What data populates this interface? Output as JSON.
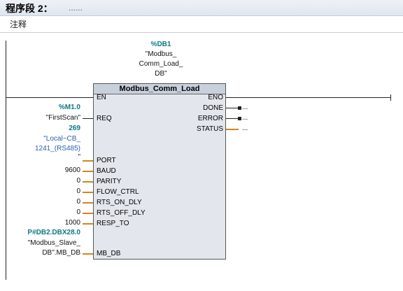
{
  "header": {
    "title": "程序段 2：",
    "dots": "......"
  },
  "comment": {
    "label": "注释"
  },
  "instance": {
    "address": "%DB1",
    "name_lines": [
      "\"Modbus_",
      "Comm_Load_",
      "DB\""
    ]
  },
  "block": {
    "title": "Modbus_Comm_Load",
    "pins_in": [
      "EN",
      "REQ",
      "PORT",
      "BAUD",
      "PARITY",
      "FLOW_CTRL",
      "RTS_ON_DLY",
      "RTS_OFF_DLY",
      "RESP_TO",
      "MB_DB"
    ],
    "pins_out": [
      "ENO",
      "DONE",
      "ERROR",
      "STATUS"
    ]
  },
  "params": {
    "req_addr": "%M1.0",
    "req_name": "\"FirstScan\"",
    "port_value": "269",
    "port_name_lines": [
      "\"Local~CB_",
      "1241_(RS485)",
      "\""
    ],
    "baud": "9600",
    "parity": "0",
    "flow_ctrl": "0",
    "rts_on_dly": "0",
    "rts_off_dly": "0",
    "resp_to": "1000",
    "mb_db_addr": "P#DB2.DBX28.0",
    "mb_db_lines": [
      "\"Modbus_Slave_",
      "DB\".MB_DB"
    ]
  },
  "outputs": {
    "done": "...",
    "error": "...",
    "status": "..."
  }
}
